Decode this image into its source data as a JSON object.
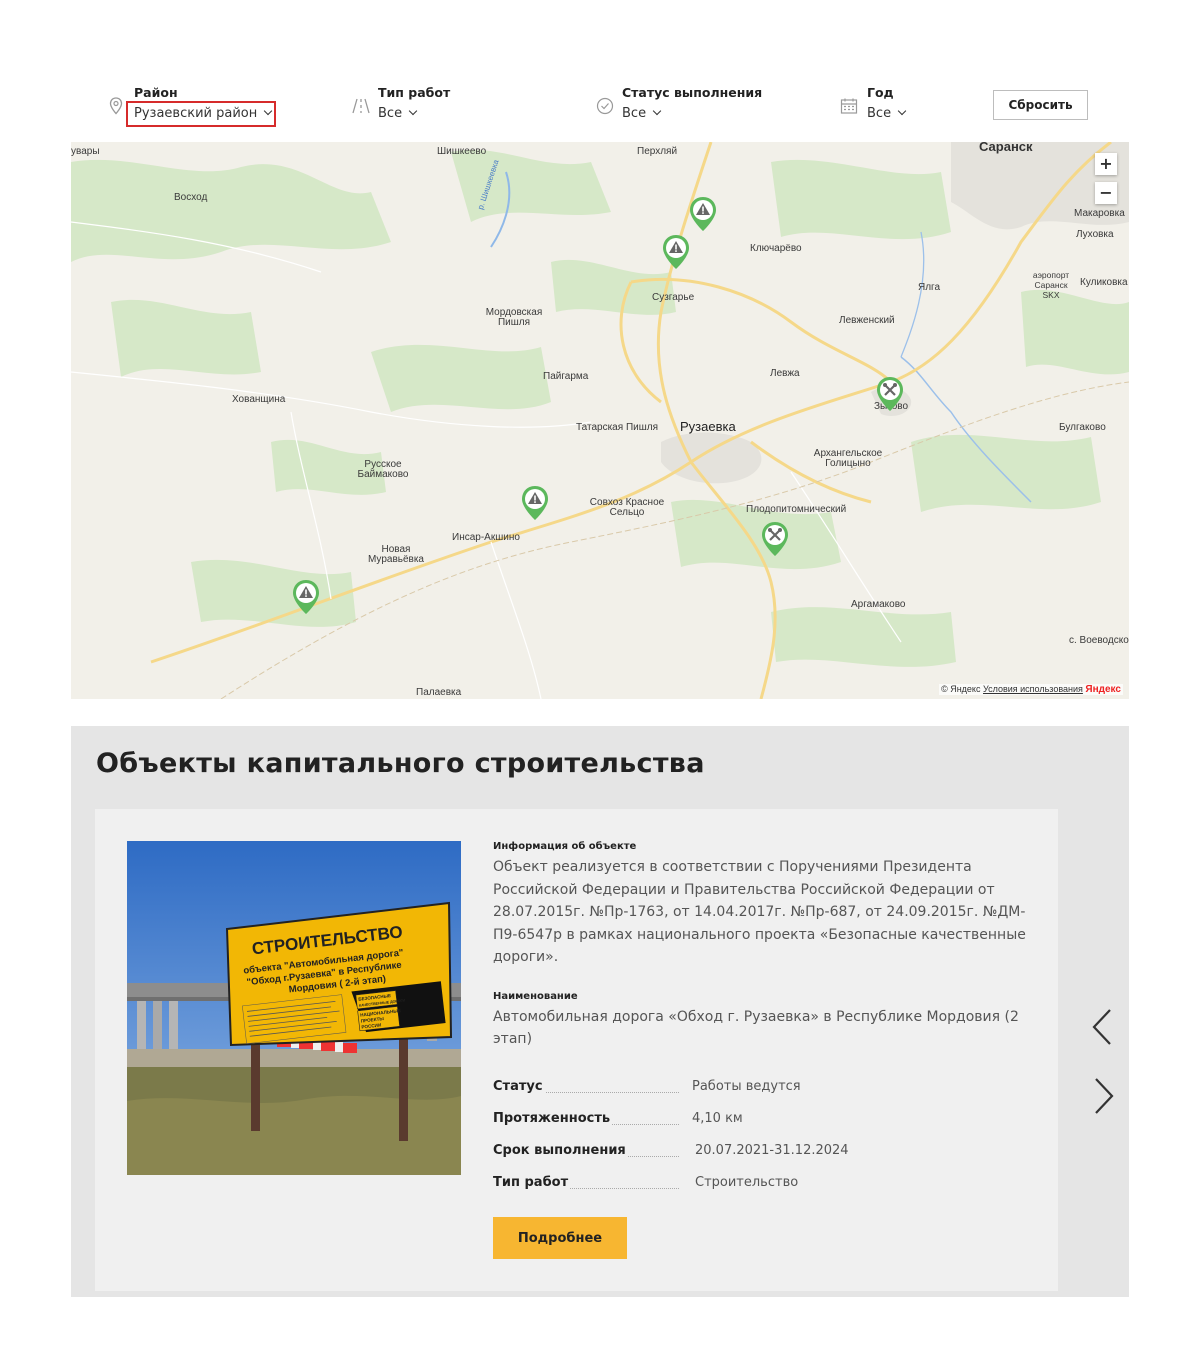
{
  "filters": {
    "district": {
      "label": "Район",
      "value": "Рузаевский район",
      "icon": "location-pin-icon"
    },
    "work_type": {
      "label": "Тип работ",
      "value": "Все",
      "icon": "road-icon"
    },
    "status": {
      "label": "Статус выполнения",
      "value": "Все",
      "icon": "check-circle-icon"
    },
    "year": {
      "label": "Год",
      "value": "Все",
      "icon": "calendar-icon"
    },
    "reset_label": "Сбросить"
  },
  "map": {
    "places": [
      "увары",
      "Шишкеево",
      "Перхляй",
      "Саранск",
      "Восход",
      "р. Шишкеевка",
      "Макаровка",
      "Луховка",
      "Ключарёво",
      "аэропорт Саранск SKX",
      "Куликовка",
      "Ялга",
      "Сузгарье",
      "Мордовская Пишля",
      "Левженский",
      "Левжа",
      "Пайгарма",
      "Хованщина",
      "Зыково",
      "Булгаково",
      "Татарская Пишля",
      "Рузаевка",
      "Архангельское Голицыно",
      "Русское Баймаково",
      "Совхоз Красное Сельцо",
      "Плодопитомнический",
      "Инсар-Акшино",
      "Новая Муравьёвка",
      "Аргамаково",
      "с. Воеводское",
      "Палаевка"
    ],
    "zoom_in": "+",
    "zoom_out": "−",
    "copyright": "© Яндекс",
    "terms": "Условия использования",
    "logo": "Яндекс",
    "marker_color": "#5cb85c"
  },
  "objects": {
    "title": "Объекты капитального строительства",
    "card": {
      "info_label": "Информация об объекте",
      "info_text": "Объект реализуется в соответствии с Поручениями Президента Российской Федерации и Правительства Российской Федерации от 28.07.2015г. №Пр-1763, от 14.04.2017г. №Пр-687, от 24.09.2015г. №ДМ-П9-6547р в рамках национального проекта «Безопасные качественные дороги».",
      "name_label": "Наименование",
      "name_text": "Автомобильная дорога «Обход г. Рузаевка» в Республике Мордовия (2 этап)",
      "status_label": "Статус",
      "status_value": "Работы ведутся",
      "length_label": "Протяженность",
      "length_value": "4,10 км",
      "term_label": "Срок выполнения",
      "term_value": "20.07.2021-31.12.2024",
      "worktype_label": "Тип работ",
      "worktype_value": "Строительство",
      "more_label": "Подробнее",
      "sign": {
        "title": "СТРОИТЕЛЬСТВО",
        "line1": "объекта \"Автомобильная дорога\"",
        "line2": "\"Обход г.Рузаевка\" в Республике",
        "line3": "Мордовия ( 2-й этап)",
        "badge1": "БЕЗОПАСНЫЕ",
        "badge2": "КАЧЕСТВЕННЫЕ ДОРОГИ",
        "badge3": "НАЦИОНАЛЬНЫЕ",
        "badge4": "ПРОЕКТЫ",
        "badge5": "РОССИИ"
      }
    }
  },
  "colors": {
    "accent_button": "#f7b631",
    "highlight_border": "#d62b2b",
    "section_bg": "#e5e5e5"
  }
}
